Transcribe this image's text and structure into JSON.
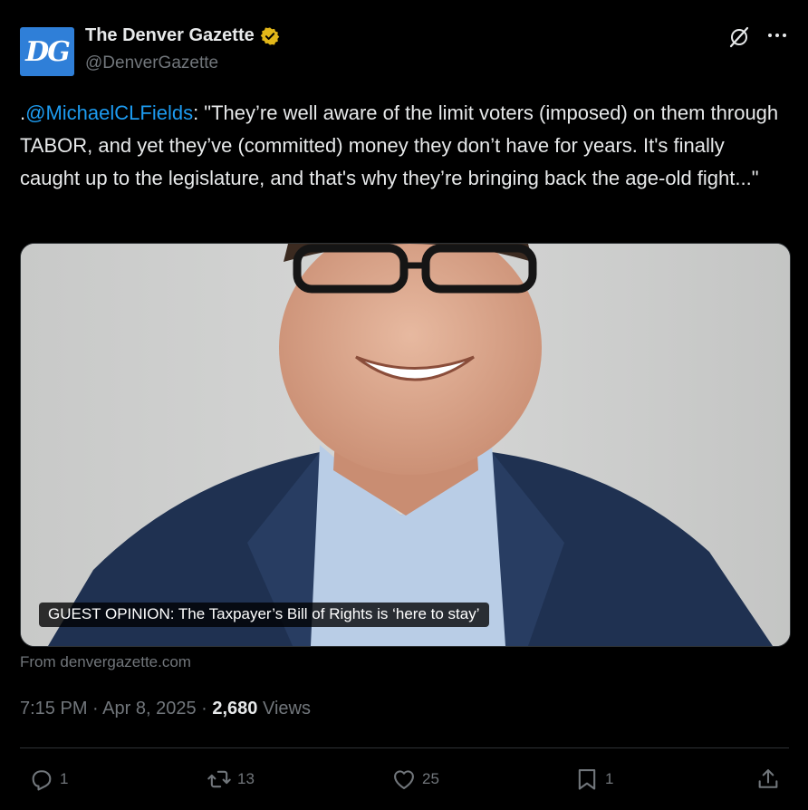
{
  "account": {
    "avatar_text": "DG",
    "display_name": "The Denver Gazette",
    "handle": "@DenverGazette",
    "verified_badge": "gold-verified-icon"
  },
  "tweet": {
    "prefix": ".",
    "mention": "@MichaelCLFields",
    "text": ": \"They’re well aware of the limit voters (imposed) on them through TABOR, and yet they’ve (committed) money they don’t have for years. It's finally caught up to the legislature, and that's why they’re bringing back the age-old fight...\""
  },
  "card": {
    "headline": "GUEST OPINION: The Taxpayer’s Bill of Rights is ‘here to stay’",
    "source": "From denvergazette.com"
  },
  "meta": {
    "time": "7:15 PM",
    "separator": " · ",
    "date": "Apr 8, 2025",
    "views_count": "2,680",
    "views_label": "Views"
  },
  "actions": {
    "replies": "1",
    "reposts": "13",
    "likes": "25",
    "bookmarks": "1"
  },
  "colors": {
    "background": "#000000",
    "text": "#e7e9ea",
    "secondary": "#71767b",
    "link": "#1d9bf0",
    "verified": "#e2b719"
  }
}
